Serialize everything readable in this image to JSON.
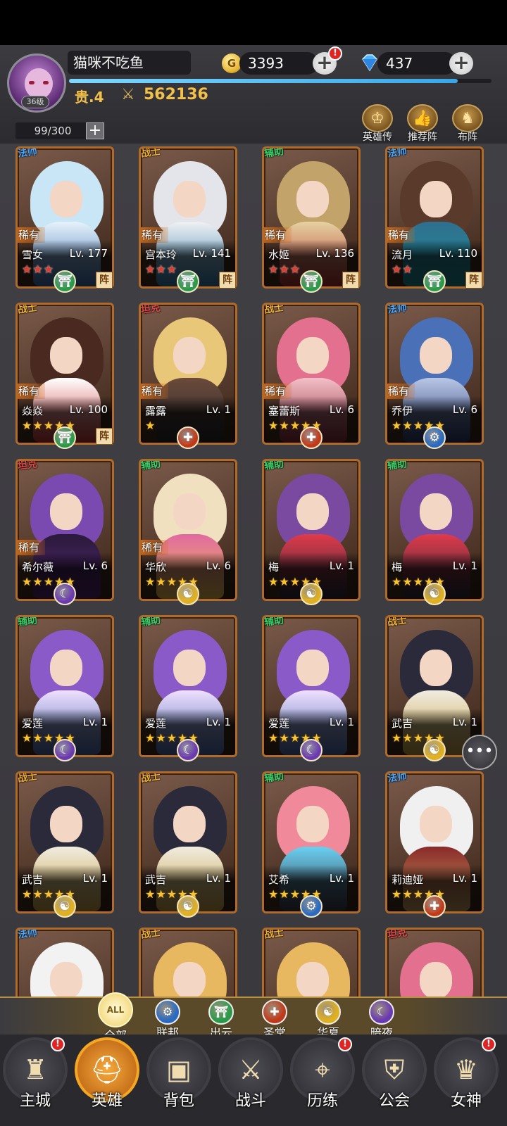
{
  "player": {
    "name": "猫咪不吃鱼",
    "level": "36级",
    "vip": "贵.4",
    "power": "562136",
    "gold": "3393",
    "gems": "437",
    "gold_alert": "!",
    "exp_progress": 0.92
  },
  "roster_capacity": "99/300",
  "top_buttons": [
    {
      "label": "英雄传",
      "icon": "crown-icon"
    },
    {
      "label": "推荐阵",
      "icon": "thumb-up-icon"
    },
    {
      "label": "布阵",
      "icon": "horse-icon"
    }
  ],
  "colors": {
    "accent": "#f5a623",
    "gold_text": "#f3c14a",
    "card_border": "#b06a2a",
    "rare_ribbon": "#d06a17"
  },
  "heroes": [
    {
      "name": "雪女",
      "level": "Lv. 177",
      "class": "法师",
      "rare": "稀有",
      "stars": 3,
      "star_color": "red",
      "faction": "出云",
      "formation": "阵",
      "palette": "ice"
    },
    {
      "name": "宫本玲",
      "level": "Lv. 141",
      "class": "战士",
      "rare": "稀有",
      "stars": 3,
      "star_color": "red",
      "faction": "出云",
      "formation": "阵",
      "palette": "silver"
    },
    {
      "name": "水姬",
      "level": "Lv. 136",
      "class": "辅助",
      "rare": "稀有",
      "stars": 3,
      "star_color": "red",
      "faction": "出云",
      "formation": "阵",
      "palette": "gold"
    },
    {
      "name": "流月",
      "level": "Lv. 110",
      "class": "法师",
      "rare": "稀有",
      "stars": 2,
      "star_color": "red",
      "faction": "出云",
      "formation": "阵",
      "palette": "teal"
    },
    {
      "name": "焱焱",
      "level": "Lv. 100",
      "class": "战士",
      "rare": "稀有",
      "stars": 5,
      "star_color": "gold",
      "faction": "出云",
      "formation": "阵",
      "palette": "red"
    },
    {
      "name": "露露",
      "level": "Lv. 1",
      "class": "坦克",
      "rare": "稀有",
      "stars": 1,
      "star_color": "gold",
      "faction": "圣堂",
      "formation": "",
      "palette": "blonde"
    },
    {
      "name": "塞蕾斯",
      "level": "Lv. 6",
      "class": "战士",
      "rare": "稀有",
      "stars": 5,
      "star_color": "gold",
      "faction": "圣堂",
      "formation": "",
      "palette": "pink"
    },
    {
      "name": "乔伊",
      "level": "Lv. 6",
      "class": "法师",
      "rare": "稀有",
      "stars": 5,
      "star_color": "gold",
      "faction": "联邦",
      "formation": "",
      "palette": "mech"
    },
    {
      "name": "希尔薇",
      "level": "Lv. 6",
      "class": "坦克",
      "rare": "稀有",
      "stars": 5,
      "star_color": "gold",
      "faction": "暗夜",
      "formation": "",
      "palette": "violet"
    },
    {
      "name": "华欣",
      "level": "Lv. 6",
      "class": "辅助",
      "rare": "稀有",
      "stars": 5,
      "star_color": "gold",
      "faction": "华夏",
      "formation": "",
      "palette": "cream"
    },
    {
      "name": "梅",
      "level": "Lv. 1",
      "class": "辅助",
      "rare": "",
      "stars": 5,
      "star_color": "gold",
      "faction": "华夏",
      "formation": "",
      "palette": "plum"
    },
    {
      "name": "梅",
      "level": "Lv. 1",
      "class": "辅助",
      "rare": "",
      "stars": 5,
      "star_color": "gold",
      "faction": "华夏",
      "formation": "",
      "palette": "plum"
    },
    {
      "name": "爱莲",
      "level": "Lv. 1",
      "class": "辅助",
      "rare": "",
      "stars": 5,
      "star_color": "gold",
      "faction": "暗夜",
      "formation": "",
      "palette": "lavender"
    },
    {
      "name": "爱莲",
      "level": "Lv. 1",
      "class": "辅助",
      "rare": "",
      "stars": 5,
      "star_color": "gold",
      "faction": "暗夜",
      "formation": "",
      "palette": "lavender"
    },
    {
      "name": "爱莲",
      "level": "Lv. 1",
      "class": "辅助",
      "rare": "",
      "stars": 5,
      "star_color": "gold",
      "faction": "暗夜",
      "formation": "",
      "palette": "lavender"
    },
    {
      "name": "武吉",
      "level": "Lv. 1",
      "class": "战士",
      "rare": "",
      "stars": 5,
      "star_color": "gold",
      "faction": "华夏",
      "formation": "",
      "palette": "warrior"
    },
    {
      "name": "武吉",
      "level": "Lv. 1",
      "class": "战士",
      "rare": "",
      "stars": 5,
      "star_color": "gold",
      "faction": "华夏",
      "formation": "",
      "palette": "warrior"
    },
    {
      "name": "武吉",
      "level": "Lv. 1",
      "class": "战士",
      "rare": "",
      "stars": 5,
      "star_color": "gold",
      "faction": "华夏",
      "formation": "",
      "palette": "warrior"
    },
    {
      "name": "艾希",
      "level": "Lv. 1",
      "class": "辅助",
      "rare": "",
      "stars": 5,
      "star_color": "gold",
      "faction": "联邦",
      "formation": "",
      "palette": "cyber"
    },
    {
      "name": "莉迪娅",
      "level": "Lv. 1",
      "class": "法师",
      "rare": "",
      "stars": 5,
      "star_color": "gold",
      "faction": "圣堂",
      "formation": "",
      "palette": "knight"
    },
    {
      "name": "",
      "level": "",
      "class": "法师",
      "rare": "",
      "stars": 0,
      "star_color": "gold",
      "faction": "",
      "formation": "",
      "palette": "white"
    },
    {
      "name": "",
      "level": "",
      "class": "战士",
      "rare": "",
      "stars": 0,
      "star_color": "gold",
      "faction": "",
      "formation": "",
      "palette": "dragon"
    },
    {
      "name": "",
      "level": "",
      "class": "战士",
      "rare": "",
      "stars": 0,
      "star_color": "gold",
      "faction": "",
      "formation": "",
      "palette": "dragon"
    },
    {
      "name": "",
      "level": "",
      "class": "坦克",
      "rare": "",
      "stars": 0,
      "star_color": "gold",
      "faction": "",
      "formation": "",
      "palette": "pink"
    }
  ],
  "filters": [
    {
      "label": "全部",
      "icon_text": "ALL",
      "icon": "all-icon",
      "active": true
    },
    {
      "label": "联邦",
      "icon_text": "⚙",
      "icon": "federation-gear-icon",
      "active": false
    },
    {
      "label": "出云",
      "icon_text": "⛩",
      "icon": "izumo-torii-icon",
      "active": false
    },
    {
      "label": "圣堂",
      "icon_text": "✚",
      "icon": "sanctum-cross-icon",
      "active": false
    },
    {
      "label": "华夏",
      "icon_text": "☯",
      "icon": "huaxia-swirl-icon",
      "active": false
    },
    {
      "label": "暗夜",
      "icon_text": "☾",
      "icon": "night-moon-icon",
      "active": false
    }
  ],
  "nav": [
    {
      "label": "主城",
      "icon": "castle-icon",
      "glyph": "♜",
      "badge": "!",
      "active": false
    },
    {
      "label": "英雄",
      "icon": "hero-helmet-icon",
      "glyph": "⛑",
      "badge": "",
      "active": true
    },
    {
      "label": "背包",
      "icon": "backpack-icon",
      "glyph": "▣",
      "badge": "",
      "active": false
    },
    {
      "label": "战斗",
      "icon": "crossed-swords-icon",
      "glyph": "⚔",
      "badge": "",
      "active": false
    },
    {
      "label": "历练",
      "icon": "map-icon",
      "glyph": "⌖",
      "badge": "!",
      "active": false
    },
    {
      "label": "公会",
      "icon": "guild-shield-icon",
      "glyph": "⛨",
      "badge": "",
      "active": false
    },
    {
      "label": "女神",
      "icon": "goddess-wings-icon",
      "glyph": "♛",
      "badge": "!",
      "active": false
    }
  ]
}
